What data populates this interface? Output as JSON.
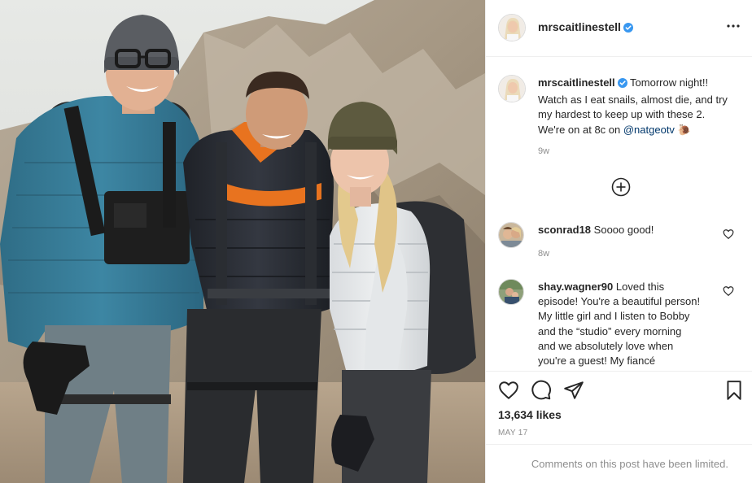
{
  "post": {
    "username": "mrscaitlinestell",
    "verified": true,
    "caption": {
      "username": "mrscaitlinestell",
      "text": "Tomorrow night!! Watch as I eat snails, almost die, and try my hardest to keep up with these 2. We're on at 8c on ",
      "mention": "@natgeotv",
      "trailing_emoji": "🐌",
      "time": "9w"
    },
    "comments": [
      {
        "username": "sconrad18",
        "text": "Soooo good!",
        "time": "8w"
      },
      {
        "username": "shay.wagner90",
        "text": "Loved this episode! You're a beautiful person! My little girl and I listen to Bobby and the “studio” every morning and we absolutely love when you're a guest! My fiancé"
      }
    ],
    "likes": "13,634 likes",
    "date": "MAY 17",
    "comments_limited": "Comments on this post have been limited."
  },
  "icons": {
    "more": "more-horizontal-icon",
    "load_more": "plus-circle-icon",
    "like": "heart-icon",
    "comment": "comment-bubble-icon",
    "share": "paper-plane-icon",
    "save": "bookmark-icon",
    "verified": "verified-badge-icon"
  },
  "colors": {
    "verified_blue": "#3897f0",
    "mention": "#00376b",
    "secondary_text": "#8e8e8e",
    "border": "#efefef"
  }
}
